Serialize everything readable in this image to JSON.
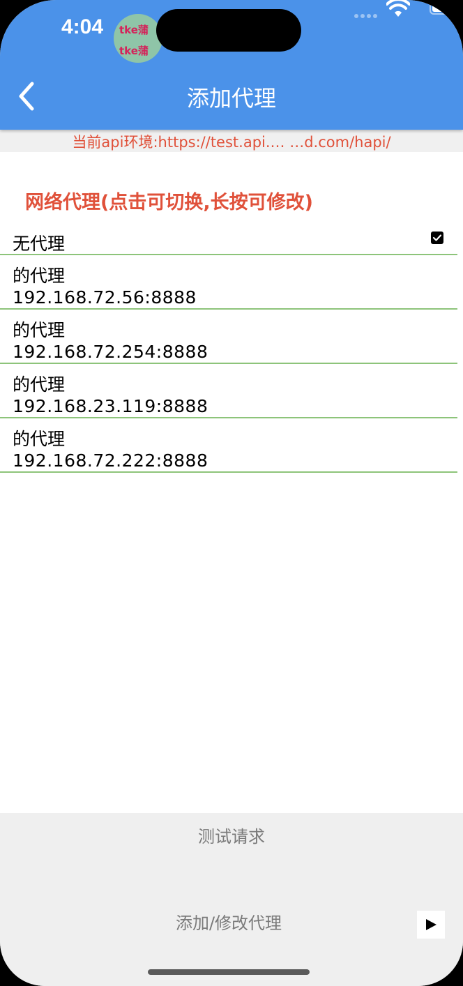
{
  "status_bar": {
    "time": "4:04",
    "overlay_text": "tke蒲"
  },
  "header": {
    "title": "添加代理",
    "background_color": "#4b92e9"
  },
  "environment": {
    "text": "当前api环境:https://test.api.…  …d.com/hapi/",
    "color": "#e0513a"
  },
  "section": {
    "title": "网络代理(点击可切换,长按可修改)"
  },
  "proxies": [
    {
      "name": "无代理",
      "address": "",
      "checked": true
    },
    {
      "name": "的代理",
      "address": "192.168.72.56:8888",
      "checked": false
    },
    {
      "name": "的代理",
      "address": "192.168.72.254:8888",
      "checked": false
    },
    {
      "name": "的代理",
      "address": "192.168.23.119:8888",
      "checked": false
    },
    {
      "name": "的代理",
      "address": "192.168.72.222:8888",
      "checked": false
    }
  ],
  "bottom": {
    "test_label": "测试请求",
    "add_label": "添加/修改代理"
  },
  "icons": {
    "back": "chevron-left-icon",
    "wifi": "wifi-icon",
    "battery": "battery-icon",
    "checkbox": "checkbox-checked-icon",
    "play": "play-icon"
  }
}
